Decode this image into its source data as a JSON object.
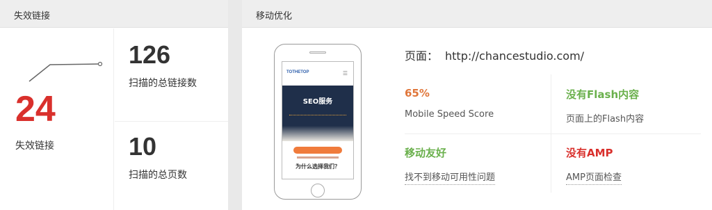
{
  "broken_links": {
    "title": "失效链接",
    "count": "24",
    "count_label": "失效链接",
    "color": "#d9302c",
    "total_links": "126",
    "total_links_label": "扫描的总链接数",
    "total_pages": "10",
    "total_pages_label": "扫描的总页数"
  },
  "mobile": {
    "title": "移动优化",
    "page_label": "页面：",
    "page_url": "http://chancestudio.com/",
    "preview": {
      "logo": "TOTHETOP",
      "menu_icon": "menu-icon",
      "hero_title": "SEO服务",
      "question": "为什么选择我们？"
    },
    "metrics": [
      {
        "value": "65%",
        "label": "Mobile Speed Score",
        "color": "#e0763a"
      },
      {
        "value": "没有Flash内容",
        "label": "页面上的Flash内容",
        "color": "#6ab04c"
      },
      {
        "value": "移动友好",
        "label": "找不到移动可用性问题",
        "color": "#6ab04c"
      },
      {
        "value": "没有AMP",
        "label": "AMP页面检查",
        "color": "#d9302c"
      }
    ]
  }
}
